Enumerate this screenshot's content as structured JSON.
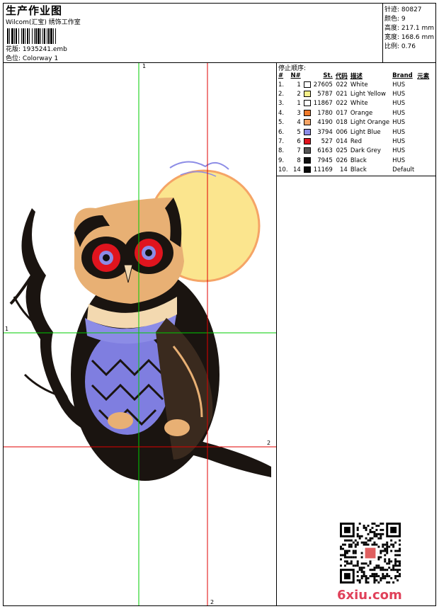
{
  "header": {
    "title": "生产作业图",
    "company": "Wilcom(汇宝) 绣饰工作室",
    "design_label": "花版: 1935241.emb",
    "colorway_label": "色位:  Colorway 1"
  },
  "summary": {
    "stitches": "针迹: 80827",
    "colors": "颜色: 9",
    "height": "高度: 217.1 mm",
    "width": "宽度: 168.6 mm",
    "scale": "比例: 0.76"
  },
  "guides": {
    "h1": "1",
    "v1": "1",
    "h2": "2",
    "v2": "2"
  },
  "stop_sequence": {
    "title": "停止顺序:",
    "columns": [
      "#",
      "N#",
      "St.",
      "代码",
      "描述",
      "Brand",
      "元素"
    ],
    "rows": [
      {
        "idx": "1.",
        "n": "1",
        "color": "#ffffff",
        "st": "27605",
        "code": "022",
        "desc": "White",
        "brand": "HUS"
      },
      {
        "idx": "2.",
        "n": "2",
        "color": "#f6f08a",
        "st": "5787",
        "code": "021",
        "desc": "Light Yellow",
        "brand": "HUS"
      },
      {
        "idx": "3.",
        "n": "1",
        "color": "#ffffff",
        "st": "11867",
        "code": "022",
        "desc": "White",
        "brand": "HUS"
      },
      {
        "idx": "4.",
        "n": "3",
        "color": "#f07a2a",
        "st": "1780",
        "code": "017",
        "desc": "Orange",
        "brand": "HUS"
      },
      {
        "idx": "5.",
        "n": "4",
        "color": "#f5a466",
        "st": "4190",
        "code": "018",
        "desc": "Light Orange",
        "brand": "HUS"
      },
      {
        "idx": "6.",
        "n": "5",
        "color": "#8c8ce6",
        "st": "3794",
        "code": "006",
        "desc": "Light Blue",
        "brand": "HUS"
      },
      {
        "idx": "7.",
        "n": "6",
        "color": "#e0141e",
        "st": "527",
        "code": "014",
        "desc": "Red",
        "brand": "HUS"
      },
      {
        "idx": "8.",
        "n": "7",
        "color": "#555555",
        "st": "6163",
        "code": "025",
        "desc": "Dark Grey",
        "brand": "HUS"
      },
      {
        "idx": "9.",
        "n": "8",
        "color": "#111111",
        "st": "7945",
        "code": "026",
        "desc": "Black",
        "brand": "HUS"
      },
      {
        "idx": "10.",
        "n": "14",
        "color": "#0a0a0a",
        "st": "11169",
        "code": "14",
        "desc": "Black",
        "brand": "Default"
      }
    ]
  },
  "watermark": {
    "logo_text": "6xiu.com"
  },
  "colors": {
    "guide_green": "#00cc00",
    "guide_red": "#e00000",
    "moon": "#fbe58e",
    "owl_blue": "#7f7ee0",
    "owl_black": "#1a1410",
    "owl_tan": "#e8b074"
  }
}
